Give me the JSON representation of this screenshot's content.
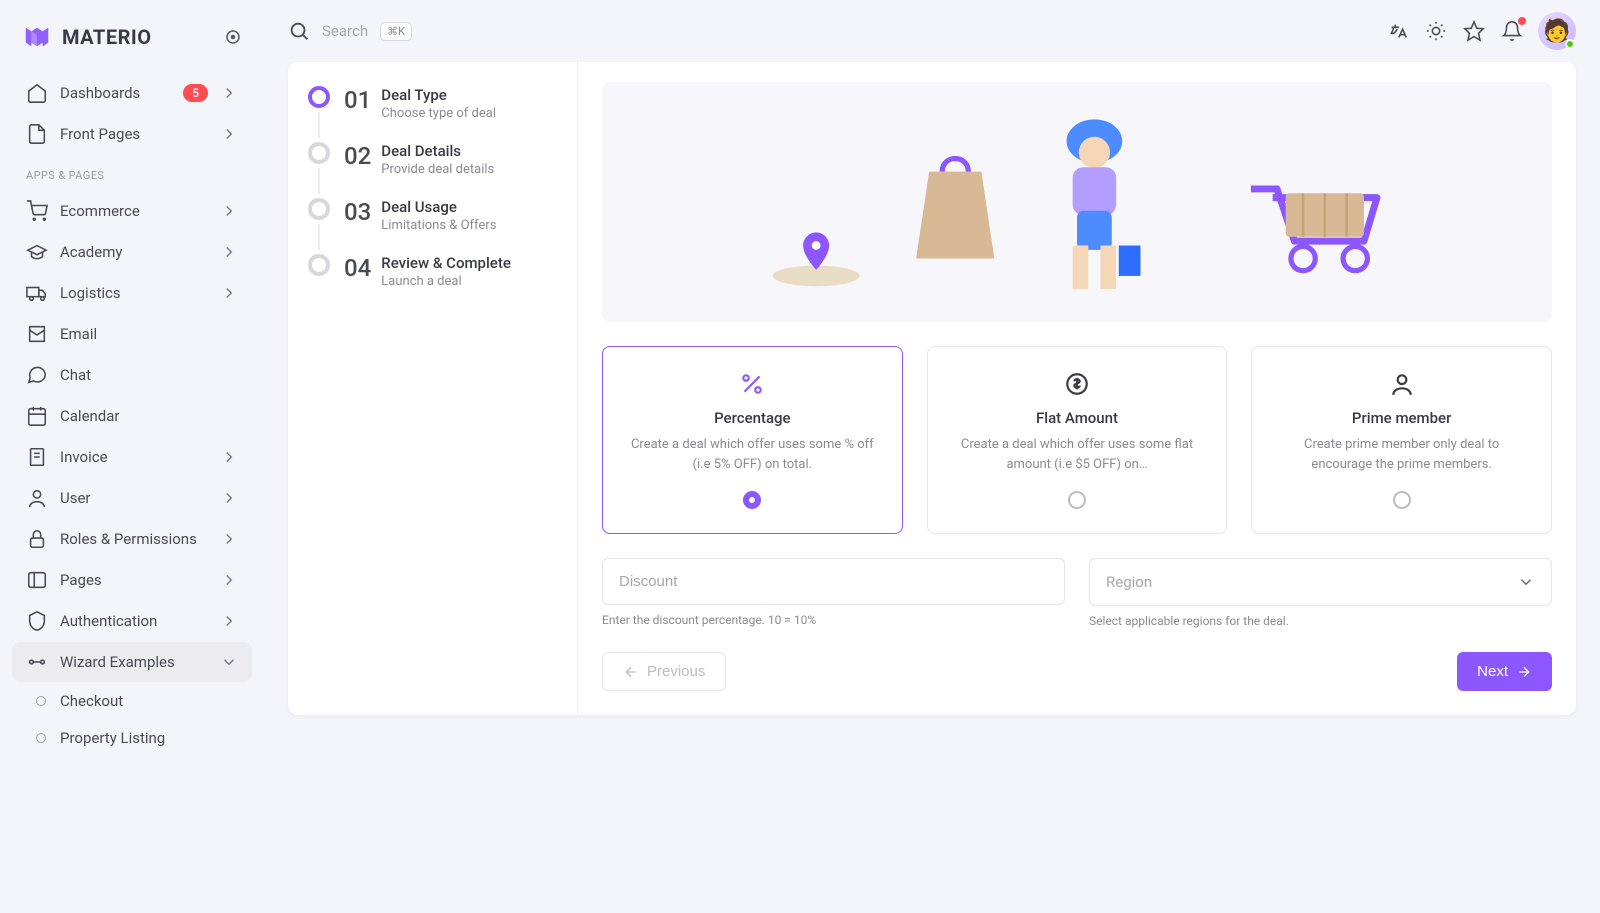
{
  "app": {
    "name": "MATERIO"
  },
  "search": {
    "placeholder": "Search",
    "shortcut": "⌘K"
  },
  "sidebar": {
    "dashboards": {
      "label": "Dashboards",
      "badge": "5"
    },
    "frontPages": {
      "label": "Front Pages"
    },
    "section": "APPS & PAGES",
    "items": [
      {
        "label": "Ecommerce"
      },
      {
        "label": "Academy"
      },
      {
        "label": "Logistics"
      },
      {
        "label": "Email"
      },
      {
        "label": "Chat"
      },
      {
        "label": "Calendar"
      },
      {
        "label": "Invoice"
      },
      {
        "label": "User"
      },
      {
        "label": "Roles & Permissions"
      },
      {
        "label": "Pages"
      },
      {
        "label": "Authentication"
      },
      {
        "label": "Wizard Examples"
      }
    ],
    "sub": [
      {
        "label": "Checkout"
      },
      {
        "label": "Property Listing"
      }
    ]
  },
  "stepper": [
    {
      "num": "01",
      "title": "Deal Type",
      "subtitle": "Choose type of deal"
    },
    {
      "num": "02",
      "title": "Deal Details",
      "subtitle": "Provide deal details"
    },
    {
      "num": "03",
      "title": "Deal Usage",
      "subtitle": "Limitations & Offers"
    },
    {
      "num": "04",
      "title": "Review & Complete",
      "subtitle": "Launch a deal"
    }
  ],
  "options": [
    {
      "title": "Percentage",
      "desc": "Create a deal which offer uses some % off (i.e 5% OFF) on total."
    },
    {
      "title": "Flat Amount",
      "desc": "Create a deal which offer uses some flat amount (i.e $5 OFF) on…"
    },
    {
      "title": "Prime member",
      "desc": "Create prime member only deal to encourage the prime members."
    }
  ],
  "form": {
    "discount": {
      "placeholder": "Discount",
      "hint": "Enter the discount percentage. 10 = 10%"
    },
    "region": {
      "placeholder": "Region",
      "hint": "Select applicable regions for the deal."
    }
  },
  "actions": {
    "previous": "Previous",
    "next": "Next"
  }
}
